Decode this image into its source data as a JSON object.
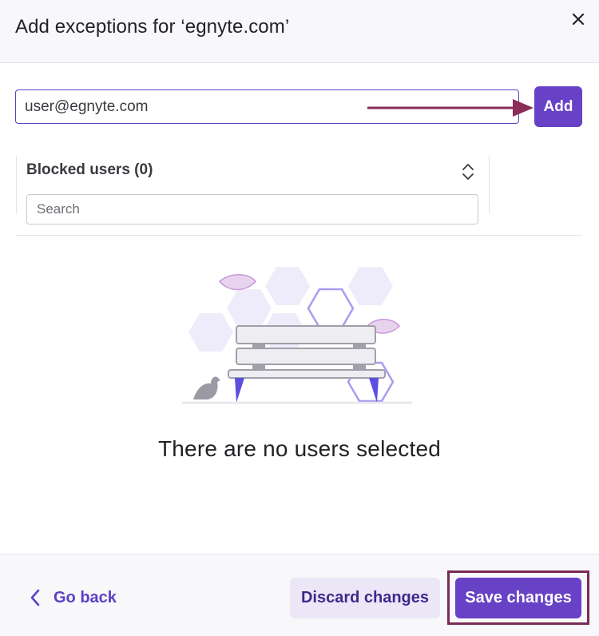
{
  "dialog": {
    "title": "Add exceptions for ‘egnyte.com’",
    "close_icon": "close-icon"
  },
  "add_form": {
    "email_value": "user@egnyte.com",
    "add_label": "Add",
    "arrow_color": "#8a2d57"
  },
  "blocked": {
    "title": "Blocked users (0)",
    "sort_icon": "sort-chevrons-icon",
    "search_placeholder": "Search"
  },
  "empty_state": {
    "illustration": "bench-with-bird-illustration",
    "message": "There are no users selected"
  },
  "footer": {
    "back_icon": "chevron-left-icon",
    "back_label": "Go back",
    "discard_label": "Discard changes",
    "save_label": "Save changes",
    "highlight_color": "#7a2a54"
  },
  "colors": {
    "primary": "#6741c6",
    "primary_light": "#ebe7f7",
    "text": "#222226"
  }
}
